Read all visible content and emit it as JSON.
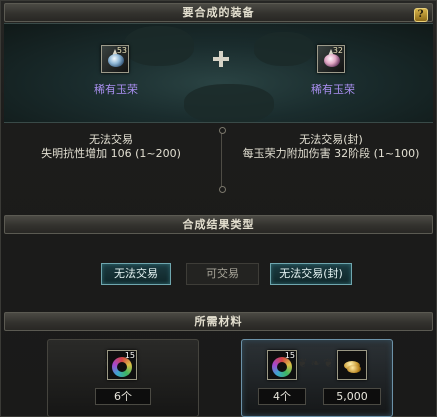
{
  "sections": {
    "equipment_title": "要合成的装备",
    "result_type_title": "合成结果类型",
    "materials_title": "所需材料",
    "help_label": "?"
  },
  "left_item": {
    "level": "53",
    "name": "稀有玉荣",
    "trade_status": "无法交易",
    "stat": "失明抗性增加 106 (1~200)"
  },
  "right_item": {
    "level": "32",
    "name": "稀有玉荣",
    "trade_status": "无法交易(封)",
    "stat": "每玉荣力附加伤害 32阶段 (1~100)"
  },
  "result_options": [
    {
      "label": "无法交易",
      "active": true
    },
    {
      "label": "可交易",
      "active": false
    },
    {
      "label": "无法交易(封)",
      "active": true
    }
  ],
  "materials": {
    "left": {
      "level": "15",
      "qty": "6个"
    },
    "right": {
      "level": "15",
      "qty": "4个",
      "gold": "5,000"
    }
  },
  "colors": {
    "item_name": "#a98ff0",
    "active_option_border": "#6fa6ae",
    "help_button": "#d7b44a"
  }
}
